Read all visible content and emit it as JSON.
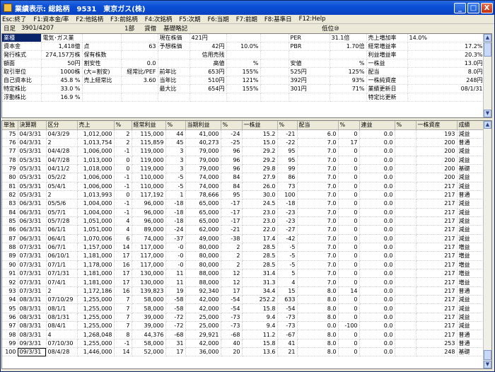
{
  "window": {
    "title": "業績表示: 総銘柄　9531　東京ガス(株)",
    "minimize": "_",
    "maximize": "□",
    "close": "X"
  },
  "menu": [
    "Esc:終了",
    "F1:資本金/率",
    "F2:他銘柄",
    "F3:前銘柄",
    "F4:次銘柄",
    "F5:次期",
    "F6:当期",
    "F7:前期",
    "F8:基準日",
    "F12:Help"
  ],
  "info": {
    "date_label": "日足",
    "date_value": "3901/4207",
    "market": "1部",
    "loan": "貸借",
    "basis": "基礎略記",
    "rank": "低位⑩"
  },
  "summary_rows": [
    [
      "業種",
      "電気･ガス業",
      "",
      "",
      "現在株価",
      "421円",
      "",
      "",
      "PER",
      "31.1倍",
      "売上増加率",
      "14.0%"
    ],
    [
      "資本金",
      "1,418億",
      "点",
      "63",
      "予想株価",
      "42円",
      "10.0%",
      "",
      "PBR",
      "1.70倍",
      "経常増益率",
      "17.2%"
    ],
    [
      "発行株式",
      "274,157万株",
      "保有株数",
      "",
      "",
      "信用売残",
      "",
      "",
      "",
      "",
      "利益増益率",
      "20.3%"
    ],
    [
      "額面",
      "50円",
      "割安性",
      "0.0",
      "",
      "高値",
      "%",
      "",
      "安値",
      "%",
      "一株益",
      "13.0円"
    ],
    [
      "取引単位",
      "1000株",
      "(大=割安)",
      "経常比/PEF",
      "前年比",
      "653円",
      "155%",
      "",
      "525円",
      "125%",
      "配当",
      "8.0円"
    ],
    [
      "自己資本比",
      "45.8 %",
      "売上経常比",
      "3.60",
      "当年比",
      "510円",
      "121%",
      "",
      "392円",
      "93%",
      "一株純資産",
      "248円"
    ],
    [
      "特定株比",
      "33.0 %",
      "",
      "",
      "最大比",
      "654円",
      "155%",
      "",
      "301円",
      "71%",
      "業績更新日",
      "08/1/31"
    ],
    [
      "浮動株比",
      "16.9 %",
      "",
      "",
      "",
      "",
      "",
      "",
      "",
      "",
      "特定比更新",
      ""
    ]
  ],
  "grid": {
    "headers": [
      "単独",
      "決算期",
      "区分",
      "売上",
      "%",
      "経常利益",
      "%",
      "当期利益",
      "%",
      "一株益",
      "%",
      "配当",
      "%",
      "連益",
      "%",
      "一株資産",
      "成績"
    ],
    "rows": [
      [
        "75",
        "04/3/31",
        "04/3/29",
        "1,012,000",
        "2",
        "115,000",
        "44",
        "41,000",
        "-24",
        "15.2",
        "-21",
        "6.0",
        "0",
        "0.0",
        "",
        "193",
        "減益"
      ],
      [
        "76",
        "04/3/31",
        "2",
        "1,013,754",
        "2",
        "115,859",
        "45",
        "40,273",
        "-25",
        "15.0",
        "-22",
        "7.0",
        "17",
        "0.0",
        "",
        "200",
        "普通"
      ],
      [
        "77",
        "05/3/31",
        "04/4/28",
        "1,006,000",
        "-1",
        "119,000",
        "3",
        "79,000",
        "96",
        "29.2",
        "95",
        "7.0",
        "0",
        "0.0",
        "",
        "200",
        "減益"
      ],
      [
        "78",
        "05/3/31",
        "04/7/28",
        "1,013,000",
        "0",
        "119,000",
        "3",
        "79,000",
        "96",
        "29.2",
        "95",
        "7.0",
        "0",
        "0.0",
        "",
        "200",
        "減益"
      ],
      [
        "79",
        "05/3/31",
        "04/11/2",
        "1,018,000",
        "0",
        "119,000",
        "3",
        "79,000",
        "96",
        "29.8",
        "99",
        "7.0",
        "0",
        "0.0",
        "",
        "200",
        "基礎"
      ],
      [
        "80",
        "05/3/31",
        "05/2/2",
        "1,006,000",
        "-1",
        "110,000",
        "-5",
        "74,000",
        "84",
        "27.9",
        "86",
        "7.0",
        "0",
        "0.0",
        "",
        "200",
        "減益"
      ],
      [
        "81",
        "05/3/31",
        "05/4/1",
        "1,006,000",
        "-1",
        "110,000",
        "-5",
        "74,000",
        "84",
        "26.0",
        "73",
        "7.0",
        "0",
        "0.0",
        "",
        "217",
        "減益"
      ],
      [
        "82",
        "05/3/31",
        "2",
        "1,013,993",
        "0",
        "117,192",
        "1",
        "78,666",
        "95",
        "30.0",
        "100",
        "7.0",
        "0",
        "0.0",
        "",
        "217",
        "普通"
      ],
      [
        "83",
        "06/3/31",
        "05/5/6",
        "1,004,000",
        "-1",
        "96,000",
        "-18",
        "65,000",
        "-17",
        "24.5",
        "-18",
        "7.0",
        "0",
        "0.0",
        "",
        "217",
        "減益"
      ],
      [
        "84",
        "06/3/31",
        "05/7/1",
        "1,004,000",
        "-1",
        "96,000",
        "-18",
        "65,000",
        "-17",
        "23.0",
        "-23",
        "7.0",
        "0",
        "0.0",
        "",
        "217",
        "減益"
      ],
      [
        "85",
        "06/3/31",
        "05/7/28",
        "1,051,000",
        "4",
        "96,000",
        "-18",
        "65,000",
        "-17",
        "23.0",
        "-23",
        "7.0",
        "0",
        "0.0",
        "",
        "217",
        "減益"
      ],
      [
        "86",
        "06/3/31",
        "06/1/1",
        "1,051,000",
        "4",
        "89,000",
        "-24",
        "62,000",
        "-21",
        "22.0",
        "-27",
        "7.0",
        "0",
        "0.0",
        "",
        "217",
        "減益"
      ],
      [
        "87",
        "06/3/31",
        "06/4/1",
        "1,070,006",
        "6",
        "74,000",
        "-37",
        "49,000",
        "-38",
        "17.4",
        "-42",
        "7.0",
        "0",
        "0.0",
        "",
        "217",
        "減益"
      ],
      [
        "88",
        "07/3/31",
        "06/7/1",
        "1,157,000",
        "14",
        "117,000",
        "-0",
        "80,000",
        "2",
        "28.5",
        "-5",
        "7.0",
        "0",
        "0.0",
        "",
        "217",
        "増益"
      ],
      [
        "89",
        "07/3/31",
        "06/10/1",
        "1,181,000",
        "17",
        "117,000",
        "-0",
        "80,000",
        "2",
        "28.5",
        "-5",
        "7.0",
        "0",
        "0.0",
        "",
        "217",
        "増益"
      ],
      [
        "90",
        "07/3/31",
        "07/1/1",
        "1,178,000",
        "16",
        "117,000",
        "-0",
        "80,000",
        "2",
        "28.5",
        "-5",
        "7.0",
        "0",
        "0.0",
        "",
        "217",
        "増益"
      ],
      [
        "91",
        "07/3/31",
        "07/1/31",
        "1,181,000",
        "17",
        "130,000",
        "11",
        "88,000",
        "12",
        "31.4",
        "5",
        "7.0",
        "0",
        "0.0",
        "",
        "217",
        "増益"
      ],
      [
        "92",
        "07/3/31",
        "07/4/1",
        "1,181,000",
        "17",
        "130,000",
        "11",
        "88,000",
        "12",
        "31.3",
        "4",
        "7.0",
        "0",
        "0.0",
        "",
        "217",
        "増益"
      ],
      [
        "93",
        "07/3/31",
        "2",
        "1,172,186",
        "16",
        "139,823",
        "19",
        "92,340",
        "17",
        "34.4",
        "15",
        "8.0",
        "14",
        "0.0",
        "",
        "217",
        "普通"
      ],
      [
        "94",
        "08/3/31",
        "07/10/29",
        "1,255,000",
        "7",
        "58,000",
        "-58",
        "42,000",
        "-54",
        "252.2",
        "633",
        "8.0",
        "0",
        "0.0",
        "",
        "217",
        "減益"
      ],
      [
        "95",
        "08/3/31",
        "08/1/1",
        "1,255,000",
        "7",
        "58,000",
        "-58",
        "42,000",
        "-54",
        "15.8",
        "-54",
        "8.0",
        "0",
        "0.0",
        "",
        "217",
        "減益"
      ],
      [
        "96",
        "08/3/31",
        "08/1/31",
        "1,255,000",
        "7",
        "39,000",
        "-72",
        "25,000",
        "-73",
        "9.4",
        "-73",
        "8.0",
        "0",
        "0.0",
        "",
        "217",
        "減益"
      ],
      [
        "97",
        "08/3/31",
        "08/4/1",
        "1,255,000",
        "7",
        "39,000",
        "-72",
        "25,000",
        "-73",
        "9.4",
        "-73",
        "0.0",
        "-100",
        "0.0",
        "",
        "217",
        "減益"
      ],
      [
        "98",
        "08/3/31",
        "4",
        "1,268,048",
        "8",
        "44,376",
        "-68",
        "29,921",
        "-68",
        "11.2",
        "-67",
        "8.0",
        "0",
        "0.0",
        "",
        "217",
        "普通"
      ],
      [
        "99",
        "09/3/31",
        "07/10/30",
        "1,255,000",
        "-1",
        "58,000",
        "31",
        "42,000",
        "40",
        "15.8",
        "41",
        "8.0",
        "0",
        "0.0",
        "",
        "253",
        "普通"
      ],
      [
        "100",
        "09/3/31",
        "08/4/28",
        "1,446,000",
        "14",
        "52,000",
        "17",
        "36,000",
        "20",
        "13.6",
        "21",
        "8.0",
        "0",
        "0.0",
        "",
        "248",
        "基礎"
      ]
    ]
  },
  "icons": {
    "app": "app-icon",
    "scroll_up": "▲",
    "scroll_down": "▼"
  }
}
